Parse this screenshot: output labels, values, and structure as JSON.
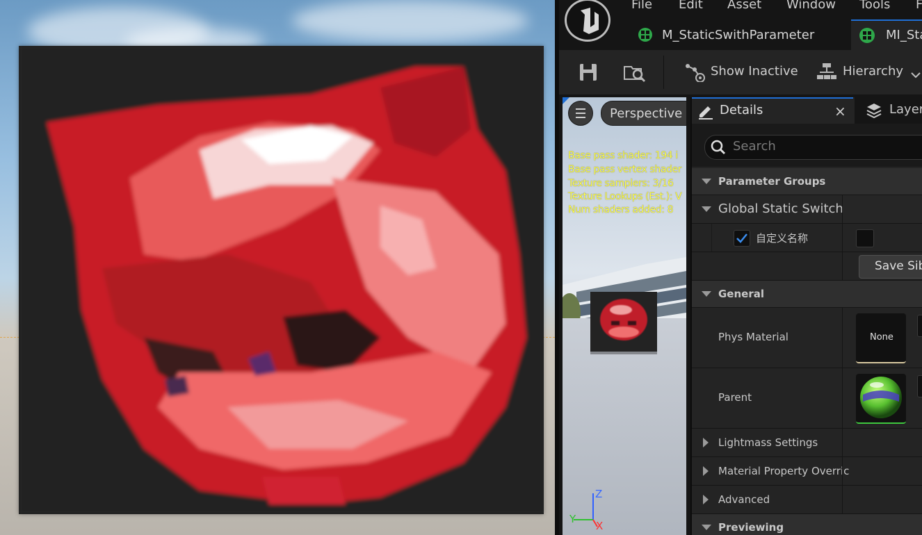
{
  "menu": [
    "File",
    "Edit",
    "Asset",
    "Window",
    "Tools",
    "F"
  ],
  "tabs": [
    {
      "label": "M_StaticSwithParameter"
    },
    {
      "label": "MI_Sta"
    }
  ],
  "toolbar": {
    "show_inactive": "Show Inactive",
    "hierarchy": "Hierarchy"
  },
  "viewport": {
    "perspective": "Perspective",
    "stats": [
      "Base pass shader: 194 i",
      "Base pass vertex shader",
      "Texture samplers: 3/16",
      "Texture Lookups (Est.): V",
      "Num shaders added: 8"
    ],
    "axis_z": "Z",
    "axis_x": "X",
    "axis_y": "Y"
  },
  "details": {
    "tab_label": "Details",
    "close": "×",
    "layers_tab": "Layer",
    "search_placeholder": "Search",
    "sections": {
      "parameter_groups": "Parameter Groups",
      "global_static_switch": "Global Static Switch",
      "custom_name": "自定义名称",
      "save_button": "Save Sib",
      "general": "General",
      "phys_material": "Phys Material",
      "phys_material_value": "None",
      "parent": "Parent",
      "lightmass": "Lightmass Settings",
      "material_property": "Material Property Overric",
      "advanced": "Advanced",
      "previewing": "Previewing"
    },
    "custom_name_checked": true,
    "switch_value_checked": false
  },
  "colors": {
    "accent_blue": "#1f6fd6",
    "panel_bg": "#242424",
    "header_bg": "#2f2f2f",
    "stats_yellow": "#ffff4a"
  }
}
